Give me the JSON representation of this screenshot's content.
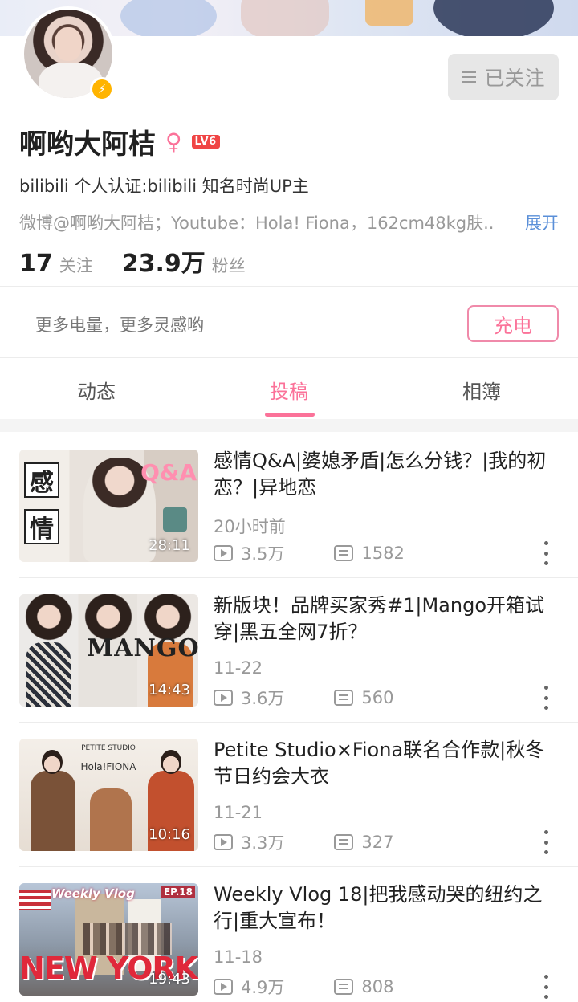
{
  "profile": {
    "name": "啊哟大阿桔",
    "level": "LV6",
    "follow_button": "已关注",
    "certification": "bilibili 个人认证:bilibili 知名时尚UP主",
    "sign": "微博@啊哟大阿桔；Youtube：Hola! Fiona，162cm48kg肤..",
    "expand": "展开",
    "following_count": "17",
    "following_label": "关注",
    "fans_count": "23.9万",
    "fans_label": "粉丝"
  },
  "charge": {
    "tip": "更多电量，更多灵感哟",
    "button": "充电"
  },
  "tabs": [
    {
      "label": "动态"
    },
    {
      "label": "投稿"
    },
    {
      "label": "相簿"
    }
  ],
  "active_tab": "投稿",
  "videos": [
    {
      "title": "感情Q&A|婆媳矛盾|怎么分钱？|我的初恋？|异地恋",
      "date": "20小时前",
      "views": "3.5万",
      "danmaku": "1582",
      "duration": "28:11",
      "thumb_text": [
        "感",
        "情",
        "Q&A"
      ]
    },
    {
      "title": "新版块！品牌买家秀#1|Mango开箱试穿|黑五全网7折？",
      "date": "11-22",
      "views": "3.6万",
      "danmaku": "560",
      "duration": "14:43",
      "thumb_text": [
        "MANGO"
      ]
    },
    {
      "title": "Petite Studio×Fiona联名合作款|秋冬节日约会大衣",
      "date": "11-21",
      "views": "3.3万",
      "danmaku": "327",
      "duration": "10:16",
      "thumb_text": [
        "PETITE STUDIO",
        "Hola!FIONA"
      ]
    },
    {
      "title": "Weekly Vlog 18|把我感动哭的纽约之行|重大宣布！",
      "date": "11-18",
      "views": "4.9万",
      "danmaku": "808",
      "duration": "19:43",
      "thumb_text": [
        "Weekly Vlog",
        "EP.18",
        "NEW YORK"
      ]
    }
  ],
  "colors": {
    "accent": "#fb7299",
    "verify": "#ffb400",
    "level": "#f04545",
    "link": "#5a8fd8"
  },
  "icons": [
    "verified-icon",
    "female-icon",
    "menu-icon",
    "play-count-icon",
    "danmaku-icon",
    "more-icon"
  ]
}
